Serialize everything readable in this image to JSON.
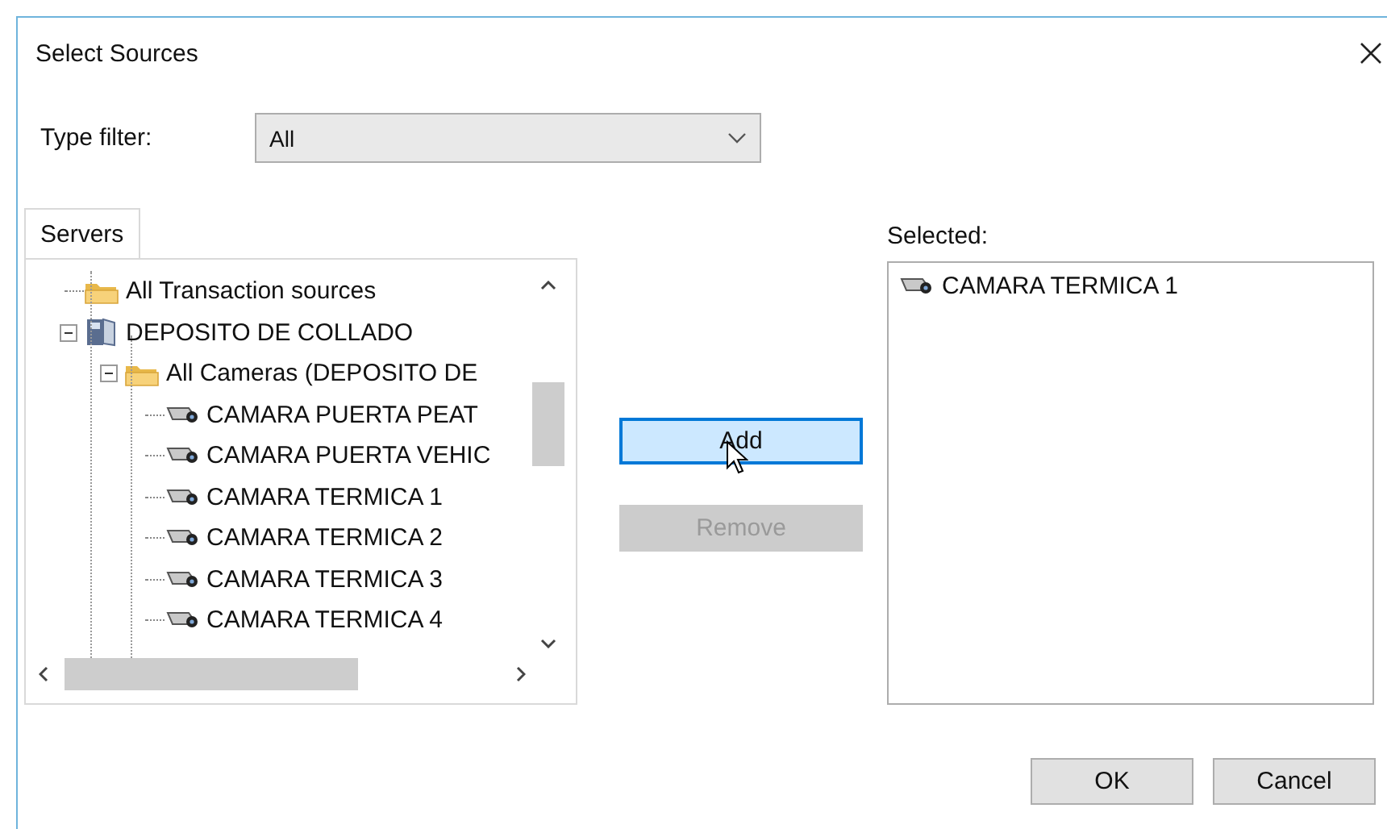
{
  "window": {
    "title": "Select Sources"
  },
  "type_filter": {
    "label": "Type filter:",
    "value": "All"
  },
  "tabs": [
    {
      "label": "Servers",
      "selected": true
    }
  ],
  "tree": {
    "items": [
      {
        "kind": "folder",
        "label": "All Transaction sources"
      },
      {
        "kind": "server",
        "label": "DEPOSITO DE COLLADO",
        "expanded": true,
        "children": [
          {
            "kind": "folder",
            "label": "All Cameras (DEPOSITO DE",
            "expanded": true,
            "children": [
              {
                "kind": "camera",
                "label": "CAMARA PUERTA PEAT"
              },
              {
                "kind": "camera",
                "label": "CAMARA PUERTA VEHIC"
              },
              {
                "kind": "camera",
                "label": "CAMARA TERMICA 1"
              },
              {
                "kind": "camera",
                "label": "CAMARA TERMICA 2"
              },
              {
                "kind": "camera",
                "label": "CAMARA TERMICA 3"
              },
              {
                "kind": "camera",
                "label": "CAMARA TERMICA 4"
              }
            ]
          }
        ]
      }
    ]
  },
  "selected_panel": {
    "label": "Selected:",
    "items": [
      {
        "kind": "camera",
        "label": "CAMARA TERMICA 1"
      }
    ]
  },
  "actions": [
    {
      "label": "Add",
      "highlighted": true,
      "disabled": false
    },
    {
      "label": "Remove",
      "highlighted": false,
      "disabled": true
    }
  ],
  "buttons": [
    "OK",
    "Cancel"
  ]
}
